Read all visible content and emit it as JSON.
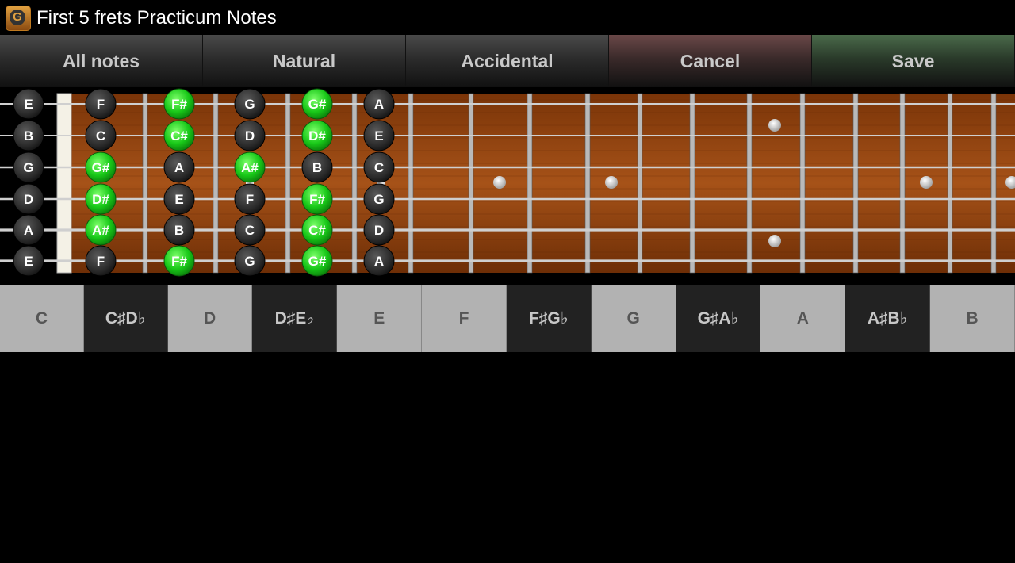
{
  "app": {
    "title": "First 5 frets Practicum Notes",
    "icon_letter": "G"
  },
  "toolbar": [
    {
      "name": "all-notes-button",
      "label": "All notes",
      "kind": "normal"
    },
    {
      "name": "natural-button",
      "label": "Natural",
      "kind": "normal"
    },
    {
      "name": "accidental-button",
      "label": "Accidental",
      "kind": "normal"
    },
    {
      "name": "cancel-button",
      "label": "Cancel",
      "kind": "cancel"
    },
    {
      "name": "save-button",
      "label": "Save",
      "kind": "save"
    }
  ],
  "fretboard": {
    "strings": [
      {
        "open": "E",
        "notes": [
          "F",
          "F#",
          "G",
          "G#",
          "A"
        ]
      },
      {
        "open": "B",
        "notes": [
          "C",
          "C#",
          "D",
          "D#",
          "E"
        ]
      },
      {
        "open": "G",
        "notes": [
          "G#",
          "A",
          "A#",
          "B",
          "C"
        ]
      },
      {
        "open": "D",
        "notes": [
          "D#",
          "E",
          "F",
          "F#",
          "G"
        ]
      },
      {
        "open": "A",
        "notes": [
          "A#",
          "B",
          "C",
          "C#",
          "D"
        ]
      },
      {
        "open": "E",
        "notes": [
          "F",
          "F#",
          "G",
          "G#",
          "A"
        ]
      }
    ],
    "colors": {
      "selected": "#22d122",
      "unselected": "#333333",
      "wood": "#9a4a12"
    }
  },
  "note_keys": [
    {
      "line1": "C",
      "line2": "",
      "kind": "nat"
    },
    {
      "line1": "C♯",
      "line2": "D♭",
      "kind": "acc"
    },
    {
      "line1": "D",
      "line2": "",
      "kind": "nat"
    },
    {
      "line1": "D♯",
      "line2": "E♭",
      "kind": "acc"
    },
    {
      "line1": "E",
      "line2": "",
      "kind": "nat"
    },
    {
      "line1": "F",
      "line2": "",
      "kind": "nat"
    },
    {
      "line1": "F♯",
      "line2": "G♭",
      "kind": "acc"
    },
    {
      "line1": "G",
      "line2": "",
      "kind": "nat"
    },
    {
      "line1": "G♯",
      "line2": "A♭",
      "kind": "acc"
    },
    {
      "line1": "A",
      "line2": "",
      "kind": "nat"
    },
    {
      "line1": "A♯",
      "line2": "B♭",
      "kind": "acc"
    },
    {
      "line1": "B",
      "line2": "",
      "kind": "nat"
    }
  ]
}
